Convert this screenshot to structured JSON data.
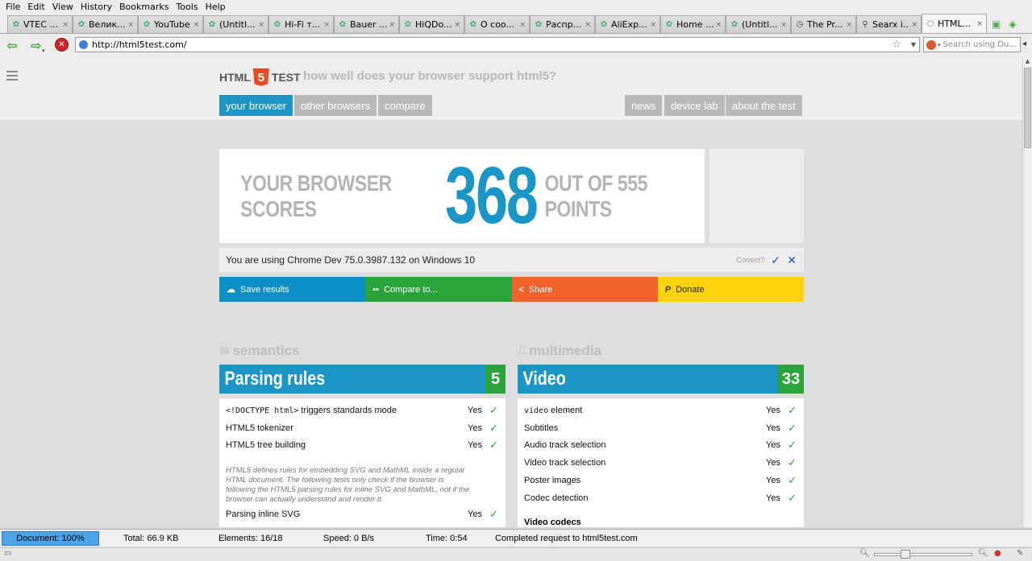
{
  "menubar": [
    "File",
    "Edit",
    "View",
    "History",
    "Bookmarks",
    "Tools",
    "Help"
  ],
  "tabs": [
    {
      "label": "VTEC ...",
      "icon": "leaf"
    },
    {
      "label": "Велик...",
      "icon": "leaf"
    },
    {
      "label": "YouTube",
      "icon": "leaf"
    },
    {
      "label": "(Untitl...",
      "icon": "leaf"
    },
    {
      "label": "Hi-Fi т...",
      "icon": "leaf"
    },
    {
      "label": "Bauer ...",
      "icon": "leaf"
    },
    {
      "label": "HiQDo...",
      "icon": "leaf"
    },
    {
      "label": "О соо...",
      "icon": "leaf"
    },
    {
      "label": "Распр...",
      "icon": "leaf"
    },
    {
      "label": "AliExp...",
      "icon": "leaf"
    },
    {
      "label": "Home ...",
      "icon": "leaf"
    },
    {
      "label": "(Untitl...",
      "icon": "leaf"
    },
    {
      "label": "The Pr...",
      "icon": "clock"
    },
    {
      "label": "Searx i...",
      "icon": "search"
    },
    {
      "label": "HTML...",
      "icon": "loading",
      "active": true
    }
  ],
  "tab_close_glyph": "×",
  "nav": {
    "url": "http://html5test.com/",
    "search_placeholder": "Search using Du..."
  },
  "site": {
    "logo_left": "HTML",
    "logo_num": "5",
    "logo_right": "TEST",
    "tagline": "how well does your browser support html5?",
    "nav_left": [
      "your browser",
      "other browsers",
      "compare"
    ],
    "nav_right": [
      "news",
      "device lab",
      "about the test"
    ],
    "active_nav": "your browser"
  },
  "score": {
    "prefix": "YOUR BROWSER SCORES",
    "value": "368",
    "suffix": "OUT OF 555 POINTS"
  },
  "using": {
    "text": "You are using Chrome Dev 75.0.3987.132 on Windows 10",
    "correct": "Correct?"
  },
  "actions": [
    {
      "label": "Save results",
      "icon": "cloud-upload-icon",
      "color": "#0b8fc4"
    },
    {
      "label": "Compare to...",
      "icon": "grid-icon",
      "color": "#2aa33a"
    },
    {
      "label": "Share",
      "icon": "share-icon",
      "color": "#f2632c"
    },
    {
      "label": "Donate",
      "icon": "paypal-icon",
      "color": "#ffd20a"
    }
  ],
  "left": {
    "category": "semantics",
    "section": "Parsing rules",
    "score": "5",
    "rows": [
      {
        "code": "<!DOCTYPE html>",
        "text": " triggers standards mode",
        "result": "Yes"
      },
      {
        "code": "",
        "text": "HTML5 tokenizer",
        "result": "Yes"
      },
      {
        "code": "",
        "text": "HTML5 tree building",
        "result": "Yes"
      }
    ],
    "note": "HTML5 defines rules for embedding SVG and MathML inside a regular HTML document. The following tests only check if the browser is following the HTML5 parsing rules for inline SVG and MathML, not if the browser can actually understand and render it.",
    "rows2": [
      {
        "text": "Parsing inline SVG",
        "result": "Yes"
      }
    ]
  },
  "right": {
    "category": "multimedia",
    "section": "Video",
    "score": "33",
    "rows": [
      {
        "code": "video",
        "text": " element",
        "result": "Yes"
      },
      {
        "code": "",
        "text": "Subtitles",
        "result": "Yes"
      },
      {
        "code": "",
        "text": "Audio track selection",
        "result": "Yes"
      },
      {
        "code": "",
        "text": "Video track selection",
        "result": "Yes"
      },
      {
        "code": "",
        "text": "Poster images",
        "result": "Yes"
      },
      {
        "code": "",
        "text": "Codec detection",
        "result": "Yes"
      }
    ],
    "subhead": "Video codecs"
  },
  "status": {
    "document": "Document: 100%",
    "total": "Total: 66.9 KB",
    "elements": "Elements: 16/18",
    "speed": "Speed: 0 B/s",
    "time": "Time: 0:54",
    "message": "Completed request to html5test.com"
  },
  "zoom": {
    "level_fraction": 0.3
  }
}
